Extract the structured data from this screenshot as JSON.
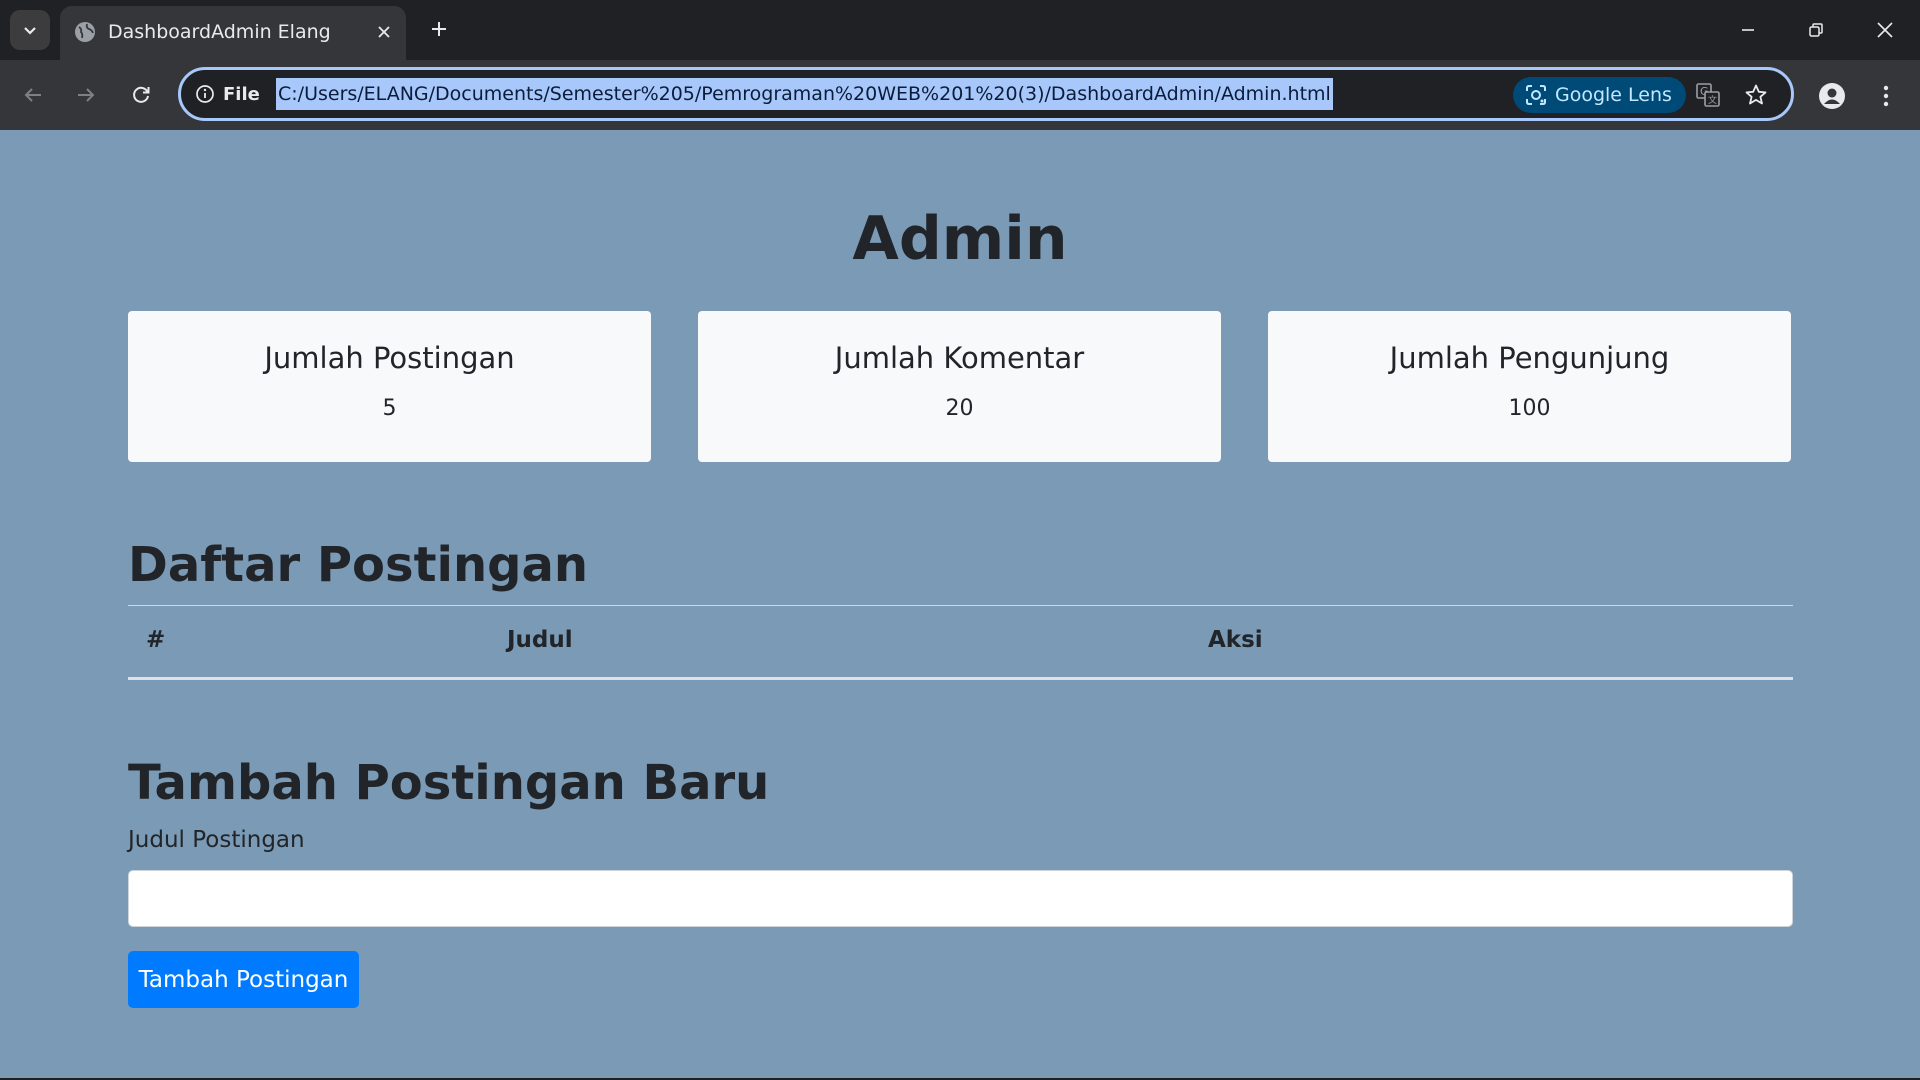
{
  "browser": {
    "tab": {
      "title": "DashboardAdmin Elang",
      "favicon": "globe-icon"
    },
    "omnibox": {
      "info_chip_label": "File",
      "url": "C:/Users/ELANG/Documents/Semester%205/Pemrograman%20WEB%201%20(3)/DashboardAdmin/Admin.html",
      "lens_label": "Google Lens"
    },
    "colors": {
      "frame": "#202124",
      "toolbar": "#35363a",
      "url_highlight": "#a8c7fa",
      "lens_chip": "#004a77"
    }
  },
  "page": {
    "title": "Admin",
    "background": "#7a9ab5",
    "cards": [
      {
        "title": "Jumlah Postingan",
        "value": "5"
      },
      {
        "title": "Jumlah Komentar",
        "value": "20"
      },
      {
        "title": "Jumlah Pengunjung",
        "value": "100"
      }
    ],
    "posts_section": {
      "title": "Daftar Postingan",
      "columns": [
        "#",
        "Judul",
        "Aksi"
      ],
      "rows": []
    },
    "add_section": {
      "title": "Tambah Postingan Baru",
      "field_label": "Judul Postingan",
      "field_value": "",
      "submit_label": "Tambah Postingan",
      "submit_color": "#007bff"
    }
  }
}
